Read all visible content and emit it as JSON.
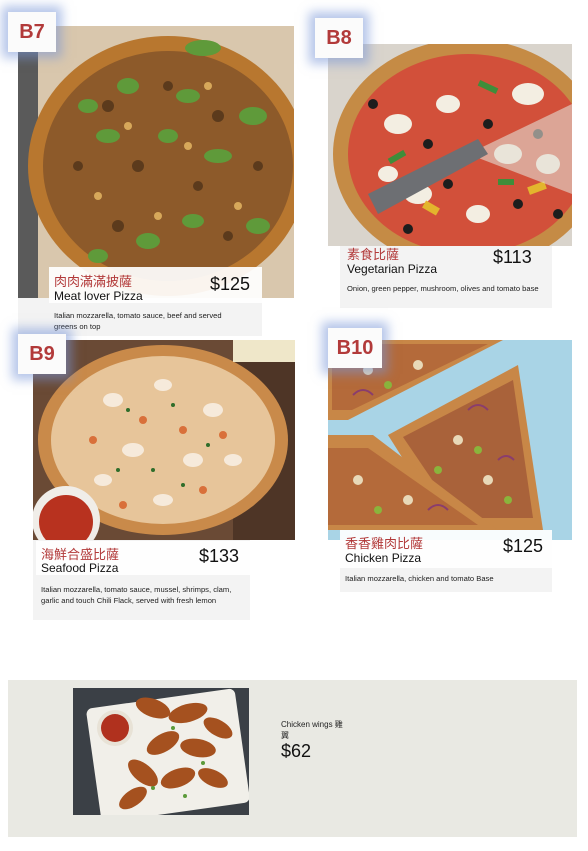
{
  "items": [
    {
      "code": "B7",
      "name_zh": "肉肉滿滿披薩",
      "name_en": "Meat lover Pizza",
      "price": "$125",
      "description": "Italian mozzarella, tomato sauce, beef  and served greens on top"
    },
    {
      "code": "B8",
      "name_zh": "素食比薩",
      "name_en": "Vegetarian Pizza",
      "price": "$113",
      "description": "Onion, green pepper, mushroom, olives and tomato base"
    },
    {
      "code": "B9",
      "name_zh": "海鮮合盛比薩",
      "name_en": "Seafood Pizza",
      "price": "$133",
      "description": "Italian mozzarella, tomato sauce, mussel, shrimps, clam, garlic and touch Chili Flack, served with fresh lemon"
    },
    {
      "code": "B10",
      "name_zh": "香香雞肉比薩",
      "name_en": "Chicken Pizza",
      "price": "$125",
      "description": "Italian mozzarella, chicken and tomato Base"
    }
  ],
  "side": {
    "name": "Chicken wings 雞翼",
    "price": "$62"
  },
  "colors": {
    "accent_red": "#b23a3a",
    "badge_glow": "#7896d7",
    "panel_bg": "#e9e9e3"
  }
}
